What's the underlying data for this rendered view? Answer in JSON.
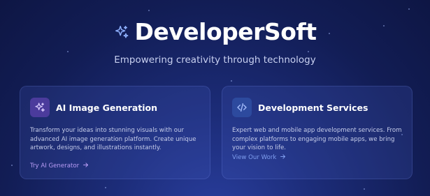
{
  "brand": {
    "title": "DeveloperSoft",
    "tagline": "Empowering creativity through technology",
    "icon": "sparkles-icon"
  },
  "cards": [
    {
      "icon": "sparkles-icon",
      "title": "AI Image Generation",
      "description": "Transform your ideas into stunning visuals with our advanced AI image generation platform. Create unique artwork, designs, and illustrations instantly.",
      "link": "Try AI Generator",
      "link_icon": "arrow-right-icon"
    },
    {
      "icon": "code-icon",
      "title": "Development Services",
      "description": "Expert web and mobile app development services. From complex platforms to engaging mobile apps, we bring your vision to life.",
      "link": "View Our Work",
      "link_icon": "arrow-right-icon"
    }
  ],
  "colors": {
    "background": "#121d55",
    "brand_icon": "#8fb1ff",
    "ai_link": "#b89cf5",
    "dev_link": "#7f9eef"
  }
}
